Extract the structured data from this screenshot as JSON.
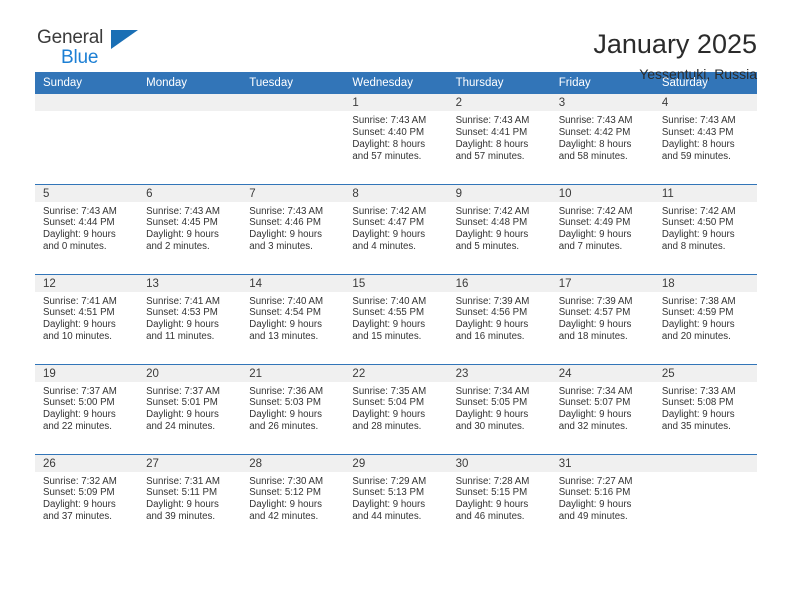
{
  "logo": {
    "line1": "General",
    "line2": "Blue",
    "triangle_color": "#1a6fb5",
    "blue_text_color": "#1c7fd4"
  },
  "header": {
    "title": "January 2025",
    "subtitle": "Yessentuki, Russia"
  },
  "theme": {
    "header_blue": "#3275b8",
    "daynum_band": "#f0f0f0",
    "text": "#333333"
  },
  "labels": {
    "sunrise_prefix": "Sunrise:",
    "sunset_prefix": "Sunset:",
    "daylight_prefix": "Daylight:"
  },
  "weekdays": [
    "Sunday",
    "Monday",
    "Tuesday",
    "Wednesday",
    "Thursday",
    "Friday",
    "Saturday"
  ],
  "weeks": [
    [
      {
        "day": "",
        "empty": true
      },
      {
        "day": "",
        "empty": true
      },
      {
        "day": "",
        "empty": true
      },
      {
        "day": "1",
        "sunrise": "Sunrise: 7:43 AM",
        "sunset": "Sunset: 4:40 PM",
        "daylight_line1": "Daylight: 8 hours",
        "daylight_line2": "and 57 minutes."
      },
      {
        "day": "2",
        "sunrise": "Sunrise: 7:43 AM",
        "sunset": "Sunset: 4:41 PM",
        "daylight_line1": "Daylight: 8 hours",
        "daylight_line2": "and 57 minutes."
      },
      {
        "day": "3",
        "sunrise": "Sunrise: 7:43 AM",
        "sunset": "Sunset: 4:42 PM",
        "daylight_line1": "Daylight: 8 hours",
        "daylight_line2": "and 58 minutes."
      },
      {
        "day": "4",
        "sunrise": "Sunrise: 7:43 AM",
        "sunset": "Sunset: 4:43 PM",
        "daylight_line1": "Daylight: 8 hours",
        "daylight_line2": "and 59 minutes."
      }
    ],
    [
      {
        "day": "5",
        "sunrise": "Sunrise: 7:43 AM",
        "sunset": "Sunset: 4:44 PM",
        "daylight_line1": "Daylight: 9 hours",
        "daylight_line2": "and 0 minutes."
      },
      {
        "day": "6",
        "sunrise": "Sunrise: 7:43 AM",
        "sunset": "Sunset: 4:45 PM",
        "daylight_line1": "Daylight: 9 hours",
        "daylight_line2": "and 2 minutes."
      },
      {
        "day": "7",
        "sunrise": "Sunrise: 7:43 AM",
        "sunset": "Sunset: 4:46 PM",
        "daylight_line1": "Daylight: 9 hours",
        "daylight_line2": "and 3 minutes."
      },
      {
        "day": "8",
        "sunrise": "Sunrise: 7:42 AM",
        "sunset": "Sunset: 4:47 PM",
        "daylight_line1": "Daylight: 9 hours",
        "daylight_line2": "and 4 minutes."
      },
      {
        "day": "9",
        "sunrise": "Sunrise: 7:42 AM",
        "sunset": "Sunset: 4:48 PM",
        "daylight_line1": "Daylight: 9 hours",
        "daylight_line2": "and 5 minutes."
      },
      {
        "day": "10",
        "sunrise": "Sunrise: 7:42 AM",
        "sunset": "Sunset: 4:49 PM",
        "daylight_line1": "Daylight: 9 hours",
        "daylight_line2": "and 7 minutes."
      },
      {
        "day": "11",
        "sunrise": "Sunrise: 7:42 AM",
        "sunset": "Sunset: 4:50 PM",
        "daylight_line1": "Daylight: 9 hours",
        "daylight_line2": "and 8 minutes."
      }
    ],
    [
      {
        "day": "12",
        "sunrise": "Sunrise: 7:41 AM",
        "sunset": "Sunset: 4:51 PM",
        "daylight_line1": "Daylight: 9 hours",
        "daylight_line2": "and 10 minutes."
      },
      {
        "day": "13",
        "sunrise": "Sunrise: 7:41 AM",
        "sunset": "Sunset: 4:53 PM",
        "daylight_line1": "Daylight: 9 hours",
        "daylight_line2": "and 11 minutes."
      },
      {
        "day": "14",
        "sunrise": "Sunrise: 7:40 AM",
        "sunset": "Sunset: 4:54 PM",
        "daylight_line1": "Daylight: 9 hours",
        "daylight_line2": "and 13 minutes."
      },
      {
        "day": "15",
        "sunrise": "Sunrise: 7:40 AM",
        "sunset": "Sunset: 4:55 PM",
        "daylight_line1": "Daylight: 9 hours",
        "daylight_line2": "and 15 minutes."
      },
      {
        "day": "16",
        "sunrise": "Sunrise: 7:39 AM",
        "sunset": "Sunset: 4:56 PM",
        "daylight_line1": "Daylight: 9 hours",
        "daylight_line2": "and 16 minutes."
      },
      {
        "day": "17",
        "sunrise": "Sunrise: 7:39 AM",
        "sunset": "Sunset: 4:57 PM",
        "daylight_line1": "Daylight: 9 hours",
        "daylight_line2": "and 18 minutes."
      },
      {
        "day": "18",
        "sunrise": "Sunrise: 7:38 AM",
        "sunset": "Sunset: 4:59 PM",
        "daylight_line1": "Daylight: 9 hours",
        "daylight_line2": "and 20 minutes."
      }
    ],
    [
      {
        "day": "19",
        "sunrise": "Sunrise: 7:37 AM",
        "sunset": "Sunset: 5:00 PM",
        "daylight_line1": "Daylight: 9 hours",
        "daylight_line2": "and 22 minutes."
      },
      {
        "day": "20",
        "sunrise": "Sunrise: 7:37 AM",
        "sunset": "Sunset: 5:01 PM",
        "daylight_line1": "Daylight: 9 hours",
        "daylight_line2": "and 24 minutes."
      },
      {
        "day": "21",
        "sunrise": "Sunrise: 7:36 AM",
        "sunset": "Sunset: 5:03 PM",
        "daylight_line1": "Daylight: 9 hours",
        "daylight_line2": "and 26 minutes."
      },
      {
        "day": "22",
        "sunrise": "Sunrise: 7:35 AM",
        "sunset": "Sunset: 5:04 PM",
        "daylight_line1": "Daylight: 9 hours",
        "daylight_line2": "and 28 minutes."
      },
      {
        "day": "23",
        "sunrise": "Sunrise: 7:34 AM",
        "sunset": "Sunset: 5:05 PM",
        "daylight_line1": "Daylight: 9 hours",
        "daylight_line2": "and 30 minutes."
      },
      {
        "day": "24",
        "sunrise": "Sunrise: 7:34 AM",
        "sunset": "Sunset: 5:07 PM",
        "daylight_line1": "Daylight: 9 hours",
        "daylight_line2": "and 32 minutes."
      },
      {
        "day": "25",
        "sunrise": "Sunrise: 7:33 AM",
        "sunset": "Sunset: 5:08 PM",
        "daylight_line1": "Daylight: 9 hours",
        "daylight_line2": "and 35 minutes."
      }
    ],
    [
      {
        "day": "26",
        "sunrise": "Sunrise: 7:32 AM",
        "sunset": "Sunset: 5:09 PM",
        "daylight_line1": "Daylight: 9 hours",
        "daylight_line2": "and 37 minutes."
      },
      {
        "day": "27",
        "sunrise": "Sunrise: 7:31 AM",
        "sunset": "Sunset: 5:11 PM",
        "daylight_line1": "Daylight: 9 hours",
        "daylight_line2": "and 39 minutes."
      },
      {
        "day": "28",
        "sunrise": "Sunrise: 7:30 AM",
        "sunset": "Sunset: 5:12 PM",
        "daylight_line1": "Daylight: 9 hours",
        "daylight_line2": "and 42 minutes."
      },
      {
        "day": "29",
        "sunrise": "Sunrise: 7:29 AM",
        "sunset": "Sunset: 5:13 PM",
        "daylight_line1": "Daylight: 9 hours",
        "daylight_line2": "and 44 minutes."
      },
      {
        "day": "30",
        "sunrise": "Sunrise: 7:28 AM",
        "sunset": "Sunset: 5:15 PM",
        "daylight_line1": "Daylight: 9 hours",
        "daylight_line2": "and 46 minutes."
      },
      {
        "day": "31",
        "sunrise": "Sunrise: 7:27 AM",
        "sunset": "Sunset: 5:16 PM",
        "daylight_line1": "Daylight: 9 hours",
        "daylight_line2": "and 49 minutes."
      },
      {
        "day": "",
        "empty": true
      }
    ]
  ]
}
